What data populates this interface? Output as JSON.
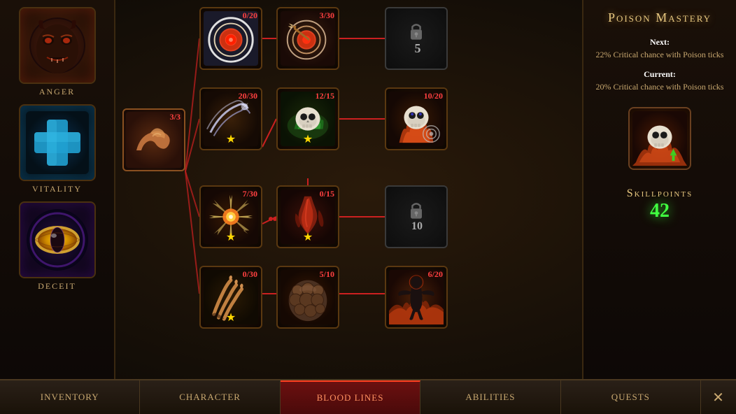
{
  "title": "Blood Lines",
  "nav": {
    "items": [
      {
        "label": "Inventory",
        "active": false,
        "id": "inventory"
      },
      {
        "label": "Character",
        "active": false,
        "id": "character"
      },
      {
        "label": "Blood Lines",
        "active": true,
        "id": "blood-lines"
      },
      {
        "label": "Abilities",
        "active": false,
        "id": "abilities"
      },
      {
        "label": "Quests",
        "active": false,
        "id": "quests"
      },
      {
        "label": "✕",
        "active": false,
        "id": "close"
      }
    ]
  },
  "left_panel": {
    "stats": [
      {
        "id": "anger",
        "label": "Anger"
      },
      {
        "id": "vitality",
        "label": "Vitality"
      },
      {
        "id": "deceit",
        "label": "Deceit"
      }
    ]
  },
  "right_panel": {
    "title": "Poison Mastery",
    "next_label": "Next:",
    "next_desc": "22% Critical chance with Poison ticks",
    "current_label": "Current:",
    "current_desc": "20% Critical chance with Poison ticks",
    "skillpoints_label": "Skillpoints",
    "skillpoints_value": "42"
  },
  "skill_tree": {
    "arm_node": {
      "count": "3/3"
    },
    "nodes": [
      {
        "id": "node-r1c1",
        "count": "0/20",
        "type": "bullseye",
        "row": 1,
        "col": 1,
        "locked": false,
        "star": false
      },
      {
        "id": "node-r1c2",
        "count": "3/30",
        "type": "bullseye-hit",
        "row": 1,
        "col": 2,
        "locked": false,
        "star": false
      },
      {
        "id": "node-r1c3",
        "count": "",
        "type": "locked",
        "row": 1,
        "col": 3,
        "locked": true,
        "lock_num": "5"
      },
      {
        "id": "node-r2c1",
        "count": "20/30",
        "type": "slash",
        "row": 2,
        "col": 1,
        "locked": false,
        "star": true
      },
      {
        "id": "node-r2c2",
        "count": "12/15",
        "type": "skull-green",
        "row": 2,
        "col": 2,
        "locked": false,
        "star": true
      },
      {
        "id": "node-r2c3",
        "count": "10/20",
        "type": "skull-fire",
        "row": 2,
        "col": 3,
        "locked": false,
        "star": false
      },
      {
        "id": "node-r3c1",
        "count": "7/30",
        "type": "burst",
        "row": 3,
        "col": 1,
        "locked": false,
        "star": true
      },
      {
        "id": "node-r3c2",
        "count": "0/15",
        "type": "blood",
        "row": 3,
        "col": 2,
        "locked": false,
        "star": true
      },
      {
        "id": "node-r3c3",
        "count": "",
        "type": "locked",
        "row": 3,
        "col": 3,
        "locked": true,
        "lock_num": "10"
      },
      {
        "id": "node-r4c1",
        "count": "0/30",
        "type": "claw",
        "row": 4,
        "col": 1,
        "locked": false,
        "star": true
      },
      {
        "id": "node-r4c2",
        "count": "5/10",
        "type": "muscle",
        "row": 4,
        "col": 2,
        "locked": false,
        "star": false
      },
      {
        "id": "node-r4c3",
        "count": "6/20",
        "type": "fire-man",
        "row": 4,
        "col": 3,
        "locked": false,
        "star": false
      }
    ]
  },
  "colors": {
    "bg": "#1a1008",
    "accent": "#c8a870",
    "active_tab": "#ff4020",
    "green": "#40ff40",
    "gold": "#ffd700",
    "red_count": "#ff4040"
  }
}
